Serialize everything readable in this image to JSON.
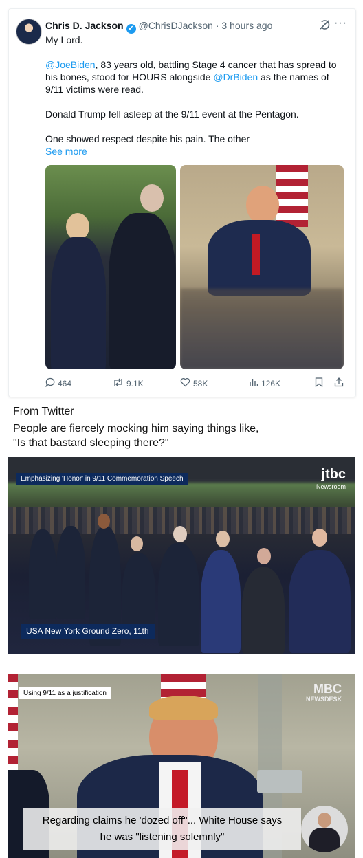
{
  "tweet": {
    "author_name": "Chris D. Jackson",
    "verified_glyph": "✔",
    "handle": "@ChrisDJackson",
    "separator": "·",
    "time": "3 hours ago",
    "line1": "My Lord.",
    "mention1": "@JoeBiden",
    "text2a": ", 83 years old, battling Stage 4 cancer that has spread to his bones, stood for HOURS alongside ",
    "mention2": "@DrBiden",
    "text2b": " as the names of 9/11 victims were read.",
    "line3": "Donald Trump fell asleep at the 9/11 event at the Pentagon.",
    "line4": "One showed respect despite his pain. The other",
    "see_more": "See more",
    "actions": {
      "replies": "464",
      "reposts": "9.1K",
      "likes": "58K",
      "views": "126K"
    },
    "icons": {
      "grok": "grok-icon",
      "more": "more-icon",
      "reply": "reply-icon",
      "repost": "repost-icon",
      "like": "heart-icon",
      "views": "views-icon",
      "bookmark": "bookmark-icon",
      "share": "share-icon"
    },
    "accent": "#1d9bf0"
  },
  "captions": {
    "source": "From Twitter",
    "line1": "People are fiercely mocking him saying things like,",
    "line2": "\"Is that bastard sleeping there?\""
  },
  "image1": {
    "tag": "Emphasizing 'Honor' in 9/11 Commemoration Speech",
    "logo_main": "jtbc",
    "logo_sub": "Newsroom",
    "location": "USA New York Ground Zero, 11th"
  },
  "image2": {
    "tag": "Using 9/11 as a justification",
    "logo_main": "MBC",
    "logo_sub": "NEWSDESK",
    "subtitle_line1": "Regarding claims he 'dozed off''... White House says",
    "subtitle_line2": "he was \"listening solemnly\""
  }
}
